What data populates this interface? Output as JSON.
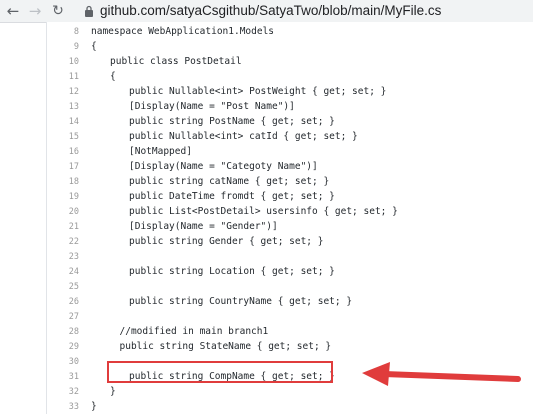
{
  "browser": {
    "back_icon": "arrow-left-icon",
    "forward_icon": "arrow-right-icon",
    "reload_icon": "reload-icon",
    "lock_icon": "lock-icon",
    "url": "github.com/satyaCsgithub/SatyaTwo/blob/main/MyFile.cs"
  },
  "code": {
    "lines": [
      {
        "n": "8",
        "indent": 0,
        "text": "namespace WebApplication1.Models"
      },
      {
        "n": "9",
        "indent": 0,
        "text": "{"
      },
      {
        "n": "10",
        "indent": 1,
        "text": "public class PostDetail"
      },
      {
        "n": "11",
        "indent": 1,
        "text": "{"
      },
      {
        "n": "12",
        "indent": 2,
        "text": "public Nullable<int> PostWeight { get; set; }"
      },
      {
        "n": "13",
        "indent": 2,
        "text": "[Display(Name = \"Post Name\")]"
      },
      {
        "n": "14",
        "indent": 2,
        "text": "public string PostName { get; set; }"
      },
      {
        "n": "15",
        "indent": 2,
        "text": "public Nullable<int> catId { get; set; }"
      },
      {
        "n": "16",
        "indent": 2,
        "text": "[NotMapped]"
      },
      {
        "n": "17",
        "indent": 2,
        "text": "[Display(Name = \"Categoty Name\")]"
      },
      {
        "n": "18",
        "indent": 2,
        "text": "public string catName { get; set; }"
      },
      {
        "n": "19",
        "indent": 2,
        "text": "public DateTime fromdt { get; set; }"
      },
      {
        "n": "20",
        "indent": 2,
        "text": "public List<PostDetail> usersinfo { get; set; }"
      },
      {
        "n": "21",
        "indent": 2,
        "text": "[Display(Name = \"Gender\")]"
      },
      {
        "n": "22",
        "indent": 2,
        "text": "public string Gender { get; set; }"
      },
      {
        "n": "23",
        "indent": 0,
        "text": ""
      },
      {
        "n": "24",
        "indent": 2,
        "text": "public string Location { get; set; }"
      },
      {
        "n": "25",
        "indent": 0,
        "text": ""
      },
      {
        "n": "26",
        "indent": 2,
        "text": "public string CountryName { get; set; }"
      },
      {
        "n": "27",
        "indent": 0,
        "text": ""
      },
      {
        "n": "28",
        "indent": 1.5,
        "text": "//modified in main branch1"
      },
      {
        "n": "29",
        "indent": 1.5,
        "text": "public string StateName { get; set; }"
      },
      {
        "n": "30",
        "indent": 0,
        "text": ""
      },
      {
        "n": "31",
        "indent": 2,
        "text": "public string CompName { get; set; }"
      },
      {
        "n": "32",
        "indent": 1,
        "text": "}"
      },
      {
        "n": "33",
        "indent": 0,
        "text": "}"
      }
    ]
  },
  "annotation": {
    "highlight_line": "31",
    "highlight_color": "#e03c3c",
    "arrow_color": "#e03c3c",
    "arrow_icon": "arrow-left-icon"
  },
  "colors": {
    "code_text": "#24292e",
    "line_number": "#9a9a9a",
    "keyword_blue": "#0000ff"
  }
}
